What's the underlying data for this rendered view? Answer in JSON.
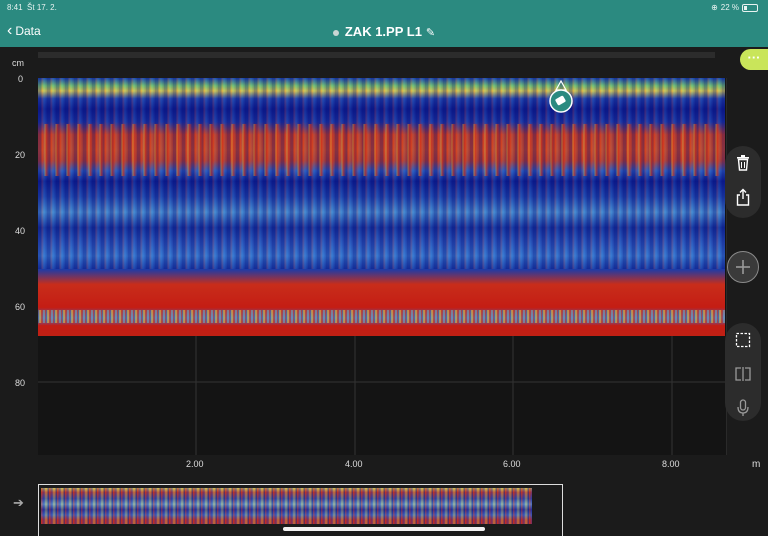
{
  "status_bar": {
    "time": "8:41",
    "date": "Št 17. 2.",
    "battery": "22 %"
  },
  "header": {
    "back_label": "Data",
    "title": "ZAK 1.PP L1"
  },
  "axis": {
    "y_unit": "cm",
    "y_ticks": [
      "0",
      "20",
      "40",
      "60",
      "80"
    ],
    "x_unit": "m",
    "x_ticks": [
      "2.00",
      "4.00",
      "6.00",
      "8.00"
    ]
  },
  "icons": {
    "back": "chevron-left-icon",
    "edit": "pencil-icon",
    "more": "ellipsis-icon",
    "delete": "trash-icon",
    "share": "share-icon",
    "add": "plus-icon",
    "select": "selection-icon",
    "split": "split-view-icon",
    "mic": "microphone-icon",
    "tag": "tag-icon",
    "overview": "arrow-right-icon"
  },
  "colors": {
    "header": "#2b8a80",
    "accent": "#c9e55a",
    "background": "#1b1b1b",
    "radar_red": "#c41d14",
    "radar_blue": "#1b46b2",
    "radar_yellow": "#e9d94a"
  }
}
